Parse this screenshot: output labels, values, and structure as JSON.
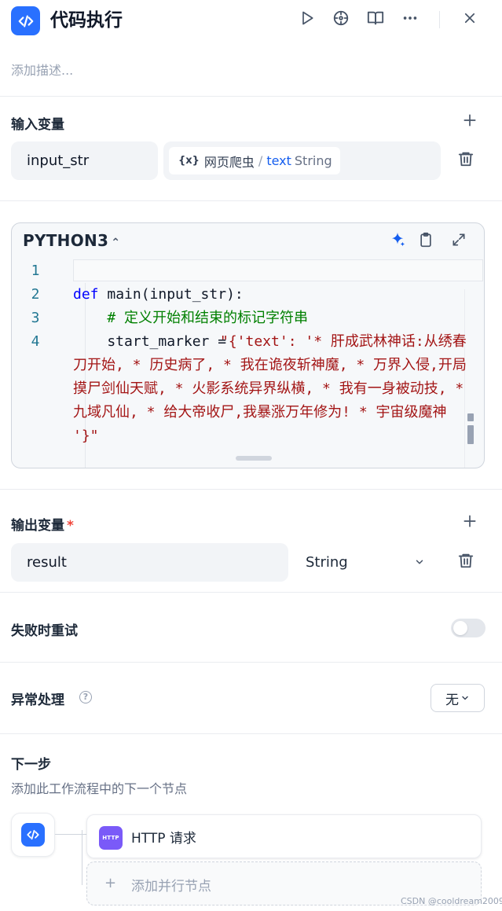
{
  "header": {
    "title": "代码执行",
    "description_placeholder": "添加描述...",
    "icons": [
      "code-icon",
      "play-icon",
      "crosshair-icon",
      "book-icon",
      "more-icon",
      "close-icon"
    ]
  },
  "input_vars": {
    "label": "输入变量",
    "rows": [
      {
        "name": "input_str",
        "ref_source": "网页爬虫",
        "ref_slash": "/",
        "ref_field": "text",
        "ref_type": "String"
      }
    ]
  },
  "editor": {
    "language": "PYTHON3",
    "lang_chevron": "⌃⌄",
    "line_numbers": [
      "1",
      "2",
      "3",
      "4"
    ],
    "code": {
      "line2_kw": "def",
      "line2_rest": " main(input_str):",
      "line3_comment": "    # 定义开始和结束的标记字符串",
      "line4_start": "    start_marker = ",
      "line4_string": "\"{'text': '* 肝成武林神话:从绣春刀开始, * 历史病了, * 我在诡夜斩神魔, * 万界入侵,开局摸尸剑仙天赋, * 火影系统异界纵横, * 我有一身被动技, * 九域凡仙, * 给大帝收尸,我暴涨万年修为! * 宇宙级魔神 '}\""
    }
  },
  "output_vars": {
    "label": "输出变量",
    "required_mark": "*",
    "rows": [
      {
        "name": "result",
        "type": "String"
      }
    ]
  },
  "retry": {
    "label": "失败时重试",
    "enabled": false
  },
  "error_handling": {
    "label": "异常处理",
    "help": "?",
    "value": "无"
  },
  "next_step": {
    "title": "下一步",
    "subtitle": "添加此工作流程中的下一个节点",
    "node_badge": "HTTP",
    "node_label": "HTTP 请求",
    "add_plus": "+",
    "add_parallel_label": "添加并行节点"
  },
  "watermark": "CSDN @cooldream2009",
  "colors": {
    "accent": "#2970ff",
    "http_badge": "#7a5af8",
    "keyword": "#0000ff",
    "comment": "#008000",
    "string": "#a31515"
  }
}
